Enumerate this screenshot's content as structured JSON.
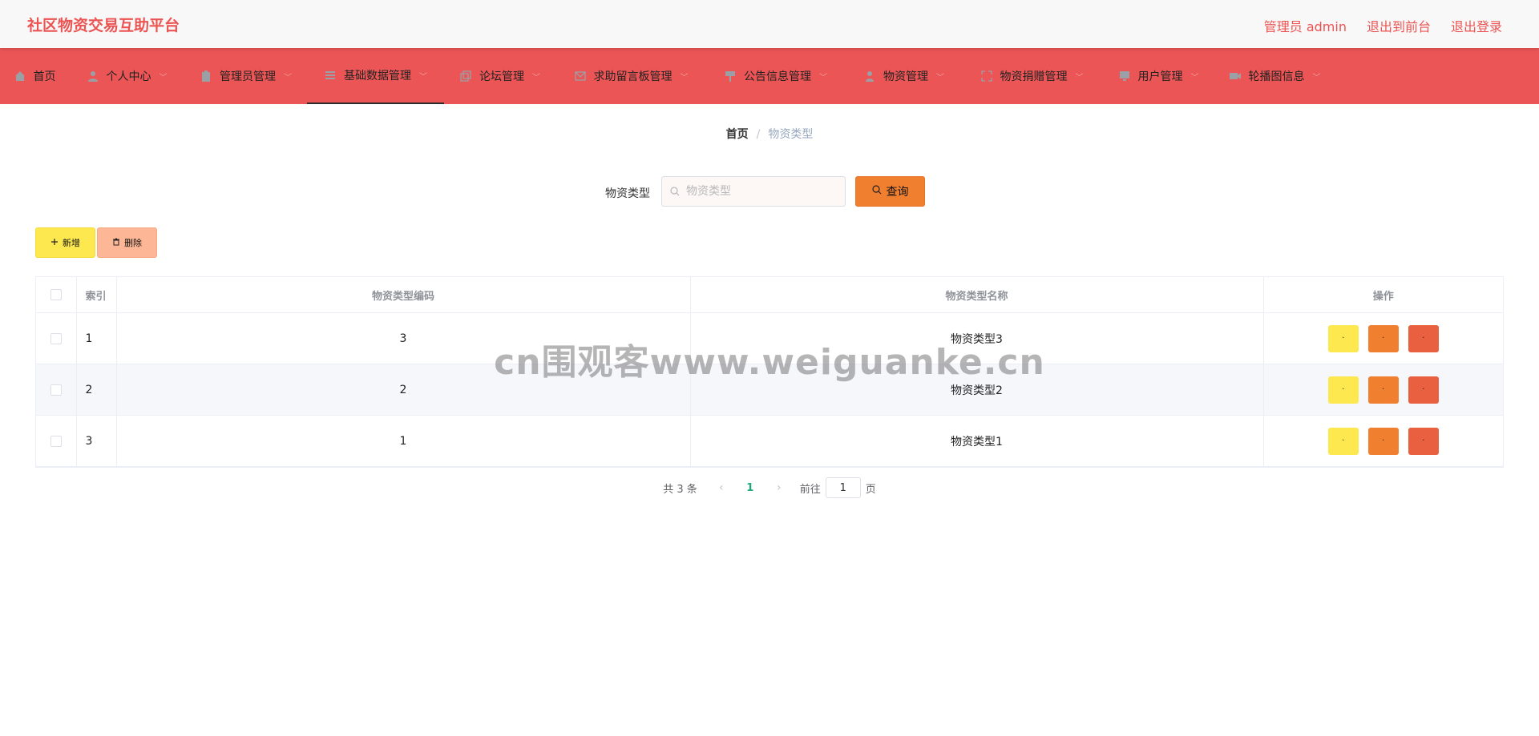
{
  "header": {
    "brand": "社区物资交易互助平台",
    "user": "管理员 admin",
    "to_front": "退出到前台",
    "logout": "退出登录"
  },
  "nav": {
    "items": [
      {
        "label": "首页",
        "icon": "home-icon",
        "has_menu": false
      },
      {
        "label": "个人中心",
        "icon": "user-icon",
        "has_menu": true
      },
      {
        "label": "管理员管理",
        "icon": "clipboard-icon",
        "has_menu": true
      },
      {
        "label": "基础数据管理",
        "icon": "list-icon",
        "has_menu": true,
        "active": true
      },
      {
        "label": "论坛管理",
        "icon": "copy-icon",
        "has_menu": true
      },
      {
        "label": "求助留言板管理",
        "icon": "message-icon",
        "has_menu": true
      },
      {
        "label": "公告信息管理",
        "icon": "sign-icon",
        "has_menu": true
      },
      {
        "label": "物资管理",
        "icon": "person-icon",
        "has_menu": true
      },
      {
        "label": "物资捐赠管理",
        "icon": "fullscreen-icon",
        "has_menu": true
      },
      {
        "label": "用户管理",
        "icon": "monitor-icon",
        "has_menu": true
      },
      {
        "label": "轮播图信息",
        "icon": "video-icon",
        "has_menu": true
      }
    ],
    "chevron": "﹀"
  },
  "breadcrumb": {
    "home": "首页",
    "separator": "/",
    "current": "物资类型"
  },
  "search": {
    "label": "物资类型",
    "placeholder": "物资类型",
    "value": "",
    "query_label": "查询"
  },
  "actions": {
    "add_label": "新增",
    "delete_label": "删除"
  },
  "table": {
    "headers": [
      "",
      "索引",
      "物资类型编码",
      "物资类型名称",
      "操作"
    ],
    "rows": [
      {
        "index": "1",
        "code": "3",
        "name": "物资类型3"
      },
      {
        "index": "2",
        "code": "2",
        "name": "物资类型2"
      },
      {
        "index": "3",
        "code": "1",
        "name": "物资类型1"
      }
    ],
    "op_label": "·"
  },
  "pagination": {
    "total": "共 3 条",
    "prev": "‹",
    "page": "1",
    "next": "›",
    "goto_label": "前往",
    "goto_value": "1",
    "page_suffix": "页"
  },
  "watermark": "cn围观客www.weiguanke.cn",
  "colors": {
    "brand": "#ec5453",
    "nav_bg": "#ec5556",
    "add_btn": "#fde84f",
    "delete_btn": "#fdb796",
    "query_btn": "#f07f2f",
    "edit_btn": "#f07f2f",
    "remove_btn": "#e8603f",
    "active_page": "#1fa97a"
  }
}
